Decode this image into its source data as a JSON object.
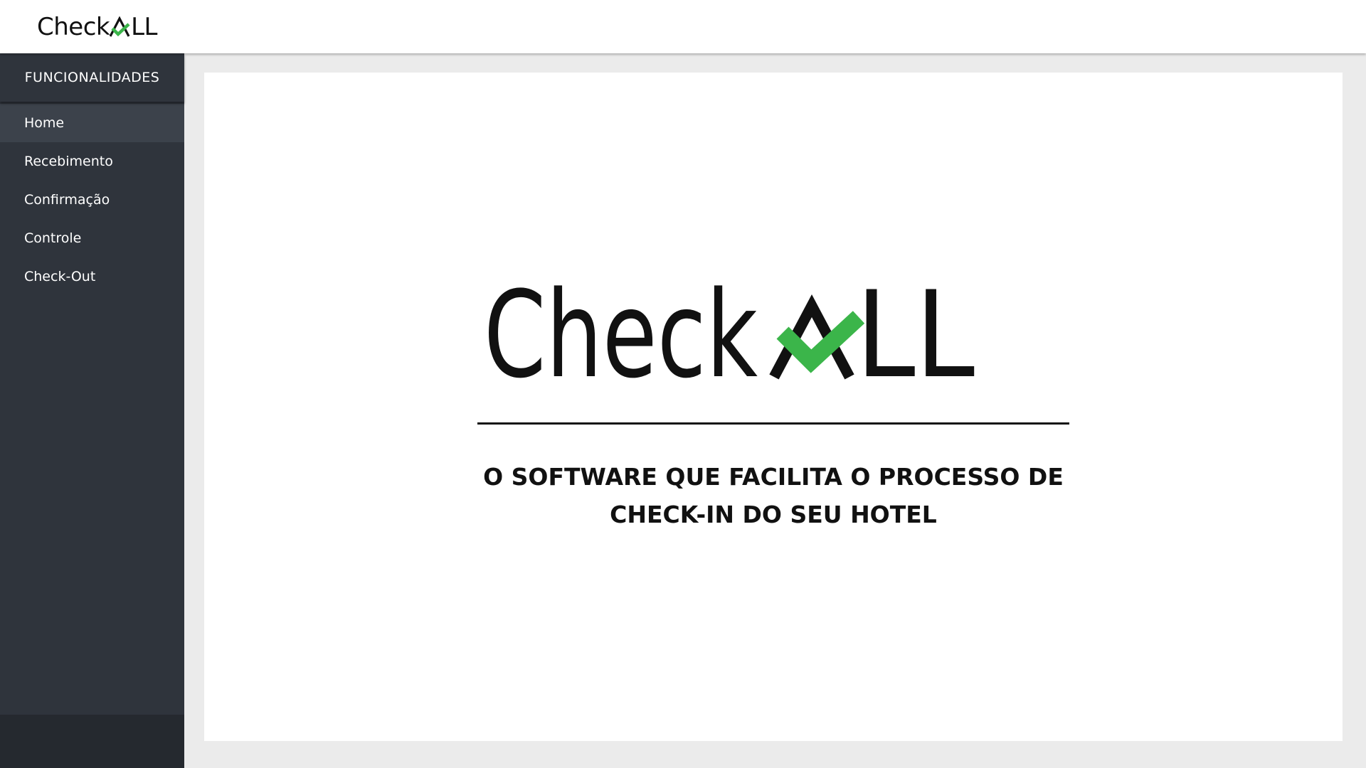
{
  "app": {
    "logo_text": "Check",
    "logo_text_suffix": "LL",
    "brand_green": "#3bb54a",
    "brand_black": "#111111"
  },
  "sidebar": {
    "header": "FUNCIONALIDADES",
    "items": [
      {
        "label": "Home",
        "active": true
      },
      {
        "label": "Recebimento",
        "active": false
      },
      {
        "label": "Confirmação",
        "active": false
      },
      {
        "label": "Controle",
        "active": false
      },
      {
        "label": "Check-Out",
        "active": false
      }
    ]
  },
  "main": {
    "tagline_line1": "O SOFTWARE QUE FACILITA O PROCESSO DE",
    "tagline_line2": "CHECK-IN DO SEU HOTEL"
  }
}
